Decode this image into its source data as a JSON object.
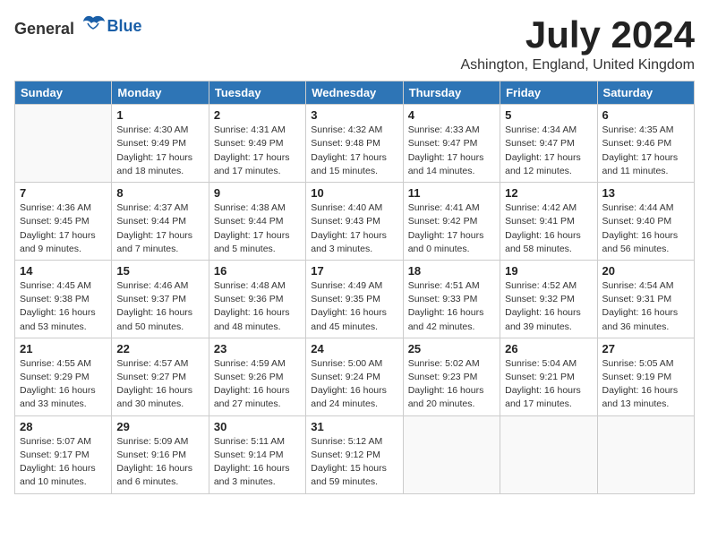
{
  "header": {
    "logo_general": "General",
    "logo_blue": "Blue",
    "month_title": "July 2024",
    "location": "Ashington, England, United Kingdom"
  },
  "weekdays": [
    "Sunday",
    "Monday",
    "Tuesday",
    "Wednesday",
    "Thursday",
    "Friday",
    "Saturday"
  ],
  "weeks": [
    [
      {
        "day": "",
        "info": ""
      },
      {
        "day": "1",
        "info": "Sunrise: 4:30 AM\nSunset: 9:49 PM\nDaylight: 17 hours\nand 18 minutes."
      },
      {
        "day": "2",
        "info": "Sunrise: 4:31 AM\nSunset: 9:49 PM\nDaylight: 17 hours\nand 17 minutes."
      },
      {
        "day": "3",
        "info": "Sunrise: 4:32 AM\nSunset: 9:48 PM\nDaylight: 17 hours\nand 15 minutes."
      },
      {
        "day": "4",
        "info": "Sunrise: 4:33 AM\nSunset: 9:47 PM\nDaylight: 17 hours\nand 14 minutes."
      },
      {
        "day": "5",
        "info": "Sunrise: 4:34 AM\nSunset: 9:47 PM\nDaylight: 17 hours\nand 12 minutes."
      },
      {
        "day": "6",
        "info": "Sunrise: 4:35 AM\nSunset: 9:46 PM\nDaylight: 17 hours\nand 11 minutes."
      }
    ],
    [
      {
        "day": "7",
        "info": "Sunrise: 4:36 AM\nSunset: 9:45 PM\nDaylight: 17 hours\nand 9 minutes."
      },
      {
        "day": "8",
        "info": "Sunrise: 4:37 AM\nSunset: 9:44 PM\nDaylight: 17 hours\nand 7 minutes."
      },
      {
        "day": "9",
        "info": "Sunrise: 4:38 AM\nSunset: 9:44 PM\nDaylight: 17 hours\nand 5 minutes."
      },
      {
        "day": "10",
        "info": "Sunrise: 4:40 AM\nSunset: 9:43 PM\nDaylight: 17 hours\nand 3 minutes."
      },
      {
        "day": "11",
        "info": "Sunrise: 4:41 AM\nSunset: 9:42 PM\nDaylight: 17 hours\nand 0 minutes."
      },
      {
        "day": "12",
        "info": "Sunrise: 4:42 AM\nSunset: 9:41 PM\nDaylight: 16 hours\nand 58 minutes."
      },
      {
        "day": "13",
        "info": "Sunrise: 4:44 AM\nSunset: 9:40 PM\nDaylight: 16 hours\nand 56 minutes."
      }
    ],
    [
      {
        "day": "14",
        "info": "Sunrise: 4:45 AM\nSunset: 9:38 PM\nDaylight: 16 hours\nand 53 minutes."
      },
      {
        "day": "15",
        "info": "Sunrise: 4:46 AM\nSunset: 9:37 PM\nDaylight: 16 hours\nand 50 minutes."
      },
      {
        "day": "16",
        "info": "Sunrise: 4:48 AM\nSunset: 9:36 PM\nDaylight: 16 hours\nand 48 minutes."
      },
      {
        "day": "17",
        "info": "Sunrise: 4:49 AM\nSunset: 9:35 PM\nDaylight: 16 hours\nand 45 minutes."
      },
      {
        "day": "18",
        "info": "Sunrise: 4:51 AM\nSunset: 9:33 PM\nDaylight: 16 hours\nand 42 minutes."
      },
      {
        "day": "19",
        "info": "Sunrise: 4:52 AM\nSunset: 9:32 PM\nDaylight: 16 hours\nand 39 minutes."
      },
      {
        "day": "20",
        "info": "Sunrise: 4:54 AM\nSunset: 9:31 PM\nDaylight: 16 hours\nand 36 minutes."
      }
    ],
    [
      {
        "day": "21",
        "info": "Sunrise: 4:55 AM\nSunset: 9:29 PM\nDaylight: 16 hours\nand 33 minutes."
      },
      {
        "day": "22",
        "info": "Sunrise: 4:57 AM\nSunset: 9:27 PM\nDaylight: 16 hours\nand 30 minutes."
      },
      {
        "day": "23",
        "info": "Sunrise: 4:59 AM\nSunset: 9:26 PM\nDaylight: 16 hours\nand 27 minutes."
      },
      {
        "day": "24",
        "info": "Sunrise: 5:00 AM\nSunset: 9:24 PM\nDaylight: 16 hours\nand 24 minutes."
      },
      {
        "day": "25",
        "info": "Sunrise: 5:02 AM\nSunset: 9:23 PM\nDaylight: 16 hours\nand 20 minutes."
      },
      {
        "day": "26",
        "info": "Sunrise: 5:04 AM\nSunset: 9:21 PM\nDaylight: 16 hours\nand 17 minutes."
      },
      {
        "day": "27",
        "info": "Sunrise: 5:05 AM\nSunset: 9:19 PM\nDaylight: 16 hours\nand 13 minutes."
      }
    ],
    [
      {
        "day": "28",
        "info": "Sunrise: 5:07 AM\nSunset: 9:17 PM\nDaylight: 16 hours\nand 10 minutes."
      },
      {
        "day": "29",
        "info": "Sunrise: 5:09 AM\nSunset: 9:16 PM\nDaylight: 16 hours\nand 6 minutes."
      },
      {
        "day": "30",
        "info": "Sunrise: 5:11 AM\nSunset: 9:14 PM\nDaylight: 16 hours\nand 3 minutes."
      },
      {
        "day": "31",
        "info": "Sunrise: 5:12 AM\nSunset: 9:12 PM\nDaylight: 15 hours\nand 59 minutes."
      },
      {
        "day": "",
        "info": ""
      },
      {
        "day": "",
        "info": ""
      },
      {
        "day": "",
        "info": ""
      }
    ]
  ]
}
